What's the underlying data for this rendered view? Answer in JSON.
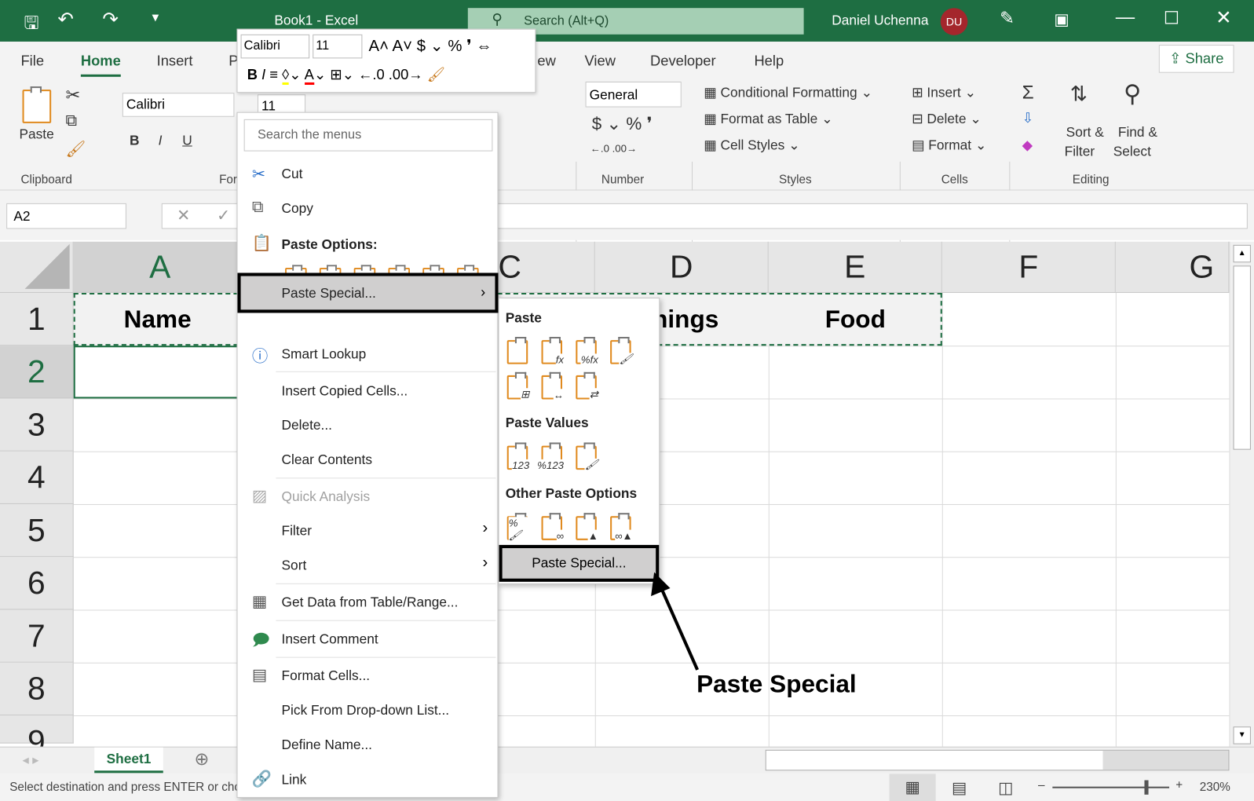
{
  "title_bar": {
    "document": "Book1  -  Excel",
    "search_placeholder": "Search (Alt+Q)",
    "user": "Daniel Uchenna",
    "avatar": "DU",
    "accent": "#1e6e42"
  },
  "ribbon_tabs": [
    "File",
    "Home",
    "Insert",
    "P",
    "ew",
    "View",
    "Developer",
    "Help"
  ],
  "share": "Share",
  "ribbon": {
    "paste": "Paste",
    "font_name": "Calibri",
    "font_size": "11",
    "number_format": "General",
    "conditional": "Conditional Formatting",
    "format_table": "Format as Table",
    "cell_styles": "Cell Styles",
    "insert": "Insert",
    "delete": "Delete",
    "format": "Format",
    "sort": "Sort &",
    "filter": "Filter",
    "find": "Find &",
    "select": "Select",
    "groups": {
      "clipboard": "Clipboard",
      "font": "For",
      "number": "Number",
      "styles": "Styles",
      "cells": "Cells",
      "editing": "Editing"
    }
  },
  "mini_toolbar": {
    "font": "Calibri",
    "size": "11"
  },
  "name_box": "A2",
  "columns": [
    "A",
    "C",
    "D",
    "E",
    "F",
    "G"
  ],
  "rows": [
    "1",
    "2",
    "3",
    "4",
    "5",
    "6",
    "7",
    "8",
    "9"
  ],
  "cells": {
    "A1": "Name",
    "D1": "hings",
    "E1": "Food"
  },
  "context_menu": {
    "search_placeholder": "Search the menus",
    "items": {
      "cut": "Cut",
      "copy": "Copy",
      "paste_options": "Paste Options:",
      "paste_special": "Paste Special...",
      "smart_lookup": "Smart Lookup",
      "insert_copied": "Insert Copied Cells...",
      "delete": "Delete...",
      "clear": "Clear Contents",
      "quick_analysis": "Quick Analysis",
      "filter": "Filter",
      "sort": "Sort",
      "get_data": "Get Data from Table/Range...",
      "insert_comment": "Insert Comment",
      "format_cells": "Format Cells...",
      "pick": "Pick From Drop-down List...",
      "define_name": "Define Name...",
      "link": "Link"
    }
  },
  "submenu": {
    "paste": "Paste",
    "paste_values": "Paste Values",
    "other": "Other Paste Options",
    "paste_special": "Paste Special..."
  },
  "annotation": "Paste Special",
  "sheet_tab": "Sheet1",
  "status": {
    "message": "Select destination and press ENTER or cho",
    "zoom": "230%",
    "zoom_level": 0.8
  }
}
